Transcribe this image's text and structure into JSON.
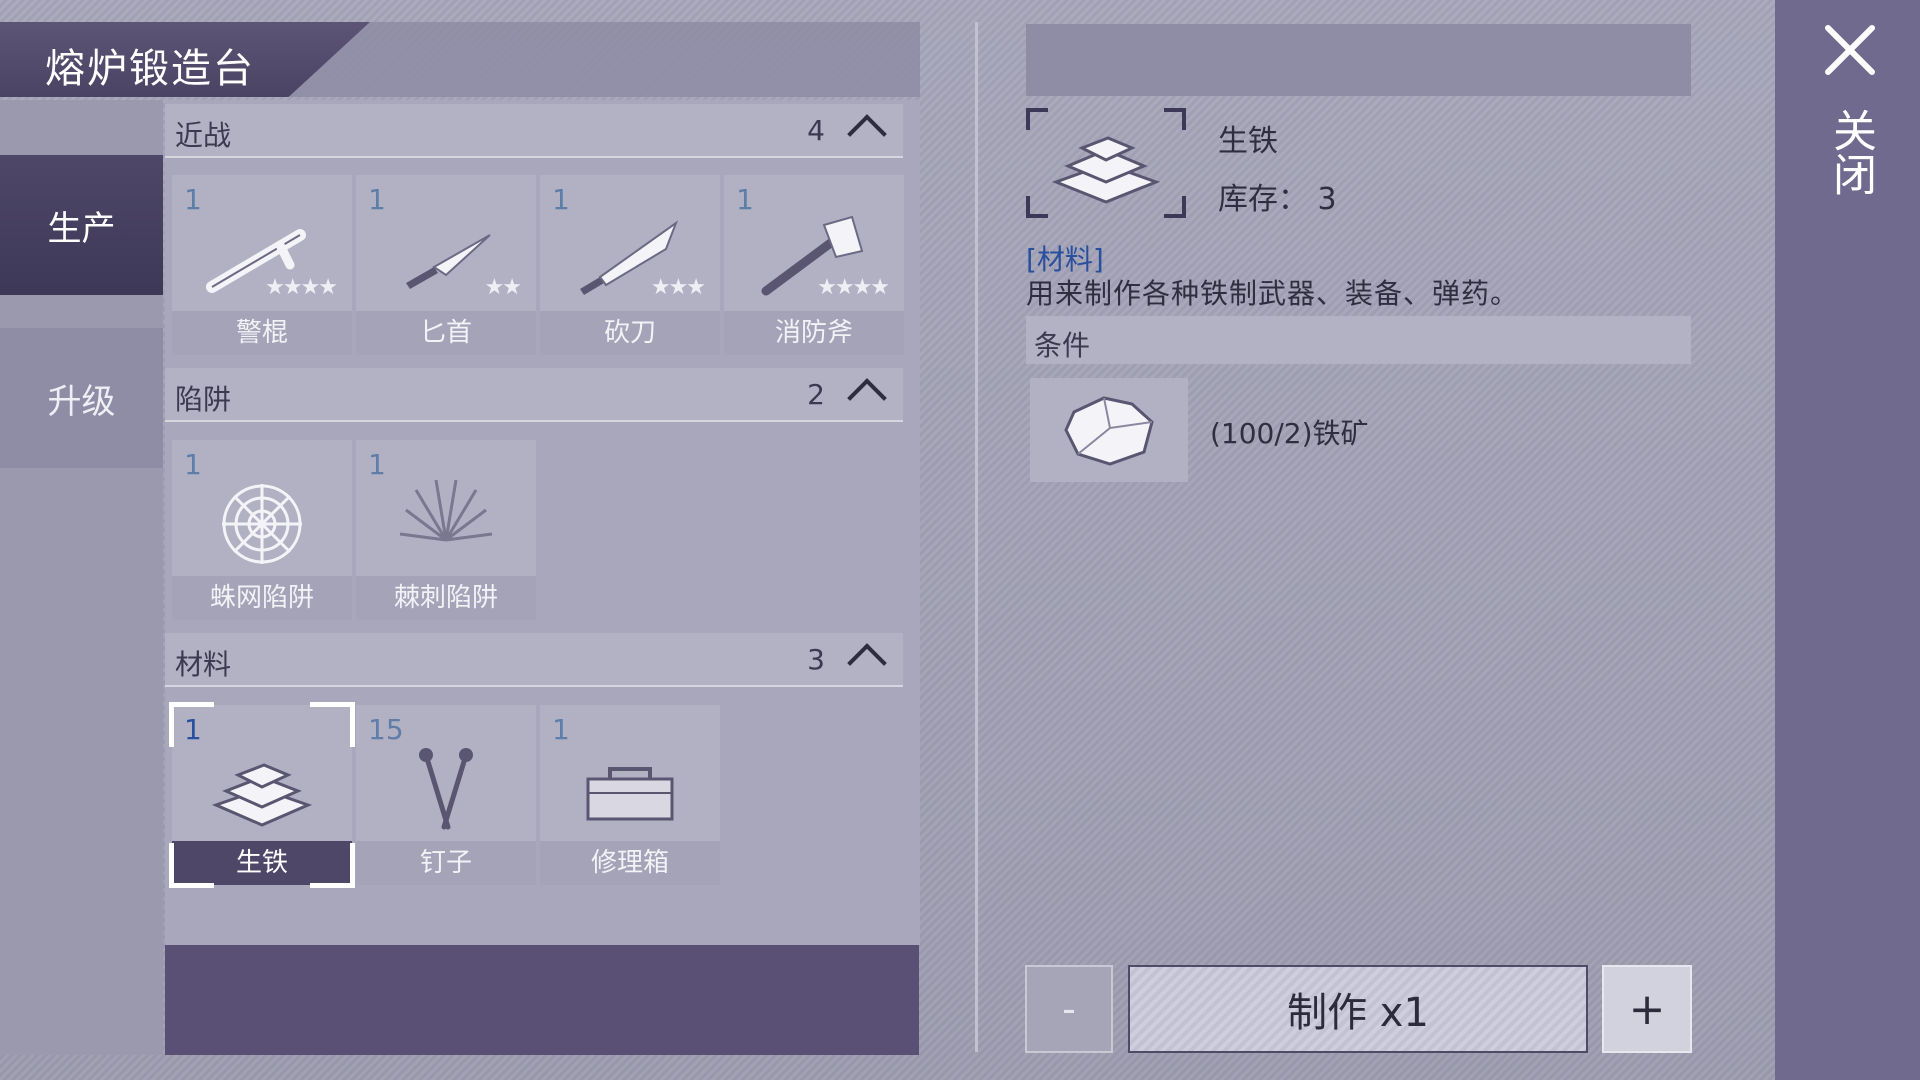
{
  "window": {
    "title": "熔炉锻造台",
    "close_label": "关闭"
  },
  "nav": {
    "items": [
      {
        "label": "生产",
        "active": true
      },
      {
        "label": "升级",
        "active": false
      }
    ]
  },
  "sections": [
    {
      "title": "近战",
      "count": "4",
      "items": [
        {
          "num": "1",
          "label": "警棍",
          "stars": "★★★★",
          "icon": "baton-icon"
        },
        {
          "num": "1",
          "label": "匕首",
          "stars": "★★",
          "icon": "dagger-icon"
        },
        {
          "num": "1",
          "label": "砍刀",
          "stars": "★★★",
          "icon": "machete-icon"
        },
        {
          "num": "1",
          "label": "消防斧",
          "stars": "★★★★",
          "icon": "fire-axe-icon"
        }
      ]
    },
    {
      "title": "陷阱",
      "count": "2",
      "items": [
        {
          "num": "1",
          "label": "蛛网陷阱",
          "icon": "web-trap-icon"
        },
        {
          "num": "1",
          "label": "棘刺陷阱",
          "icon": "spike-trap-icon"
        }
      ]
    },
    {
      "title": "材料",
      "count": "3",
      "items": [
        {
          "num": "1",
          "label": "生铁",
          "icon": "iron-ingot-icon",
          "selected": true
        },
        {
          "num": "15",
          "label": "钉子",
          "icon": "nails-icon"
        },
        {
          "num": "1",
          "label": "修理箱",
          "icon": "toolbox-icon"
        }
      ]
    }
  ],
  "detail": {
    "name": "生铁",
    "stock": "库存： 3",
    "type": "[材料]",
    "description": "用来制作各种铁制武器、装备、弹药。",
    "conditions_title": "条件",
    "requirement": "(100/2)铁矿",
    "requirement_icon": "iron-ore-icon",
    "icon": "iron-ingot-icon"
  },
  "actions": {
    "minus": "-",
    "make": "制作 x1",
    "plus": "+"
  },
  "colors": {
    "accent": "#4e4767",
    "type_tag": "#2a4f9d",
    "count_text": "#5e7ea8"
  }
}
